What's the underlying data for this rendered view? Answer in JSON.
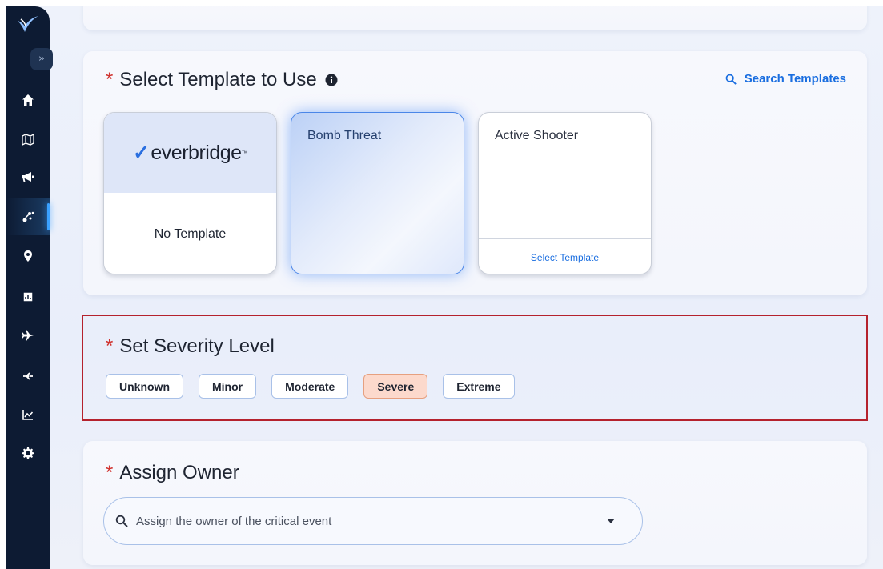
{
  "sidebar": {
    "expand_glyph": "»",
    "items": [
      {
        "icon": "home-icon",
        "active": false
      },
      {
        "icon": "map-icon",
        "active": false
      },
      {
        "icon": "megaphone-icon",
        "active": false
      },
      {
        "icon": "people-network-icon",
        "active": true
      },
      {
        "icon": "location-pin-icon",
        "active": false
      },
      {
        "icon": "bar-chart-icon",
        "active": false
      },
      {
        "icon": "airplane-icon",
        "active": false
      },
      {
        "icon": "satellite-icon",
        "active": false
      },
      {
        "icon": "line-chart-icon",
        "active": false
      },
      {
        "icon": "gear-icon",
        "active": false
      }
    ]
  },
  "template_section": {
    "required_mark": "*",
    "title": "Select Template to Use",
    "search_label": "Search Templates",
    "templates": [
      {
        "name": "No Template",
        "brand": "everbridge"
      },
      {
        "name": "Bomb Threat",
        "selected": true
      },
      {
        "name": "Active Shooter",
        "action": "Select Template"
      }
    ]
  },
  "severity_section": {
    "required_mark": "*",
    "title": "Set Severity Level",
    "levels": [
      "Unknown",
      "Minor",
      "Moderate",
      "Severe",
      "Extreme"
    ],
    "selected": "Severe"
  },
  "owner_section": {
    "required_mark": "*",
    "title": "Assign Owner",
    "placeholder": "Assign the owner of the critical event"
  },
  "colors": {
    "sidebar_bg": "#0d1b33",
    "accent_blue": "#1a6ee0",
    "required_red": "#d0312d",
    "highlight_border": "#b5222d",
    "severe_selected_bg": "#fcd9cc"
  }
}
